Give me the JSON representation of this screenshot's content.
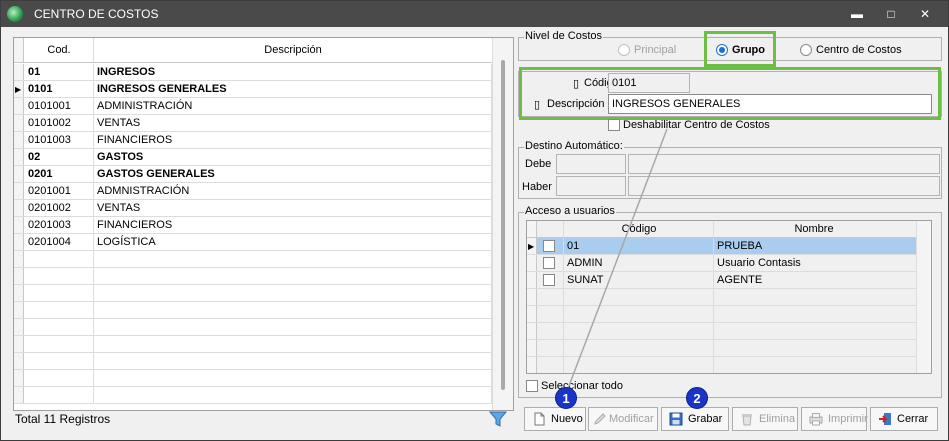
{
  "window": {
    "title": "CENTRO DE COSTOS",
    "minimize_glyph": "▬",
    "maximize_glyph": "□",
    "close_glyph": "✕"
  },
  "table": {
    "columns": [
      "Cod.",
      "Descripción"
    ],
    "rows": [
      {
        "cod": "01",
        "desc": "INGRESOS",
        "bold": true
      },
      {
        "cod": "0101",
        "desc": "INGRESOS GENERALES",
        "bold": true,
        "current": true
      },
      {
        "cod": "0101001",
        "desc": "ADMINISTRACIÓN",
        "bold": false
      },
      {
        "cod": "0101002",
        "desc": "VENTAS",
        "bold": false
      },
      {
        "cod": "0101003",
        "desc": "FINANCIEROS",
        "bold": false
      },
      {
        "cod": "02",
        "desc": "GASTOS",
        "bold": true
      },
      {
        "cod": "0201",
        "desc": "GASTOS GENERALES",
        "bold": true
      },
      {
        "cod": "0201001",
        "desc": "ADMNISTRACIÓN",
        "bold": false
      },
      {
        "cod": "0201002",
        "desc": "VENTAS",
        "bold": false
      },
      {
        "cod": "0201003",
        "desc": "FINANCIEROS",
        "bold": false
      },
      {
        "cod": "0201004",
        "desc": "LOGÍSTICA",
        "bold": false
      }
    ],
    "total": "Total 11 Registros"
  },
  "nivel": {
    "label": "Nivel de Costos",
    "options": [
      "Principal",
      "Grupo",
      "Centro de Costos"
    ],
    "selected": "Grupo"
  },
  "form": {
    "codigo_label": "Código",
    "codigo_value": "0101",
    "descripcion_label": "Descripción",
    "descripcion_value": "INGRESOS GENERALES",
    "deshabilitar_label": "Deshabilitar Centro de Costos"
  },
  "destino": {
    "label": "Destino Automático:",
    "debe_label": "Debe",
    "haber_label": "Haber"
  },
  "acceso": {
    "label": "Acceso a usuarios",
    "columns": [
      "Código",
      "Nombre"
    ],
    "rows": [
      {
        "codigo": "01",
        "nombre": "PRUEBA",
        "selected": true
      },
      {
        "codigo": "ADMIN",
        "nombre": "Usuario Contasis",
        "selected": false
      },
      {
        "codigo": "SUNAT",
        "nombre": "AGENTE",
        "selected": false
      }
    ],
    "select_all_label": "Seleccionar todo"
  },
  "toolbar": {
    "nuevo": "Nuevo",
    "modificar": "Modificar",
    "grabar": "Grabar",
    "elimina": "Elimina",
    "imprimir": "Imprimir",
    "cerrar": "Cerrar"
  },
  "annotations": {
    "badge1": "1",
    "badge2": "2"
  },
  "colors": {
    "highlight": "#6cbf44",
    "badge": "#1a34c8",
    "selected_row": "#a9cdee",
    "titlebar": "#4a4a4a"
  }
}
